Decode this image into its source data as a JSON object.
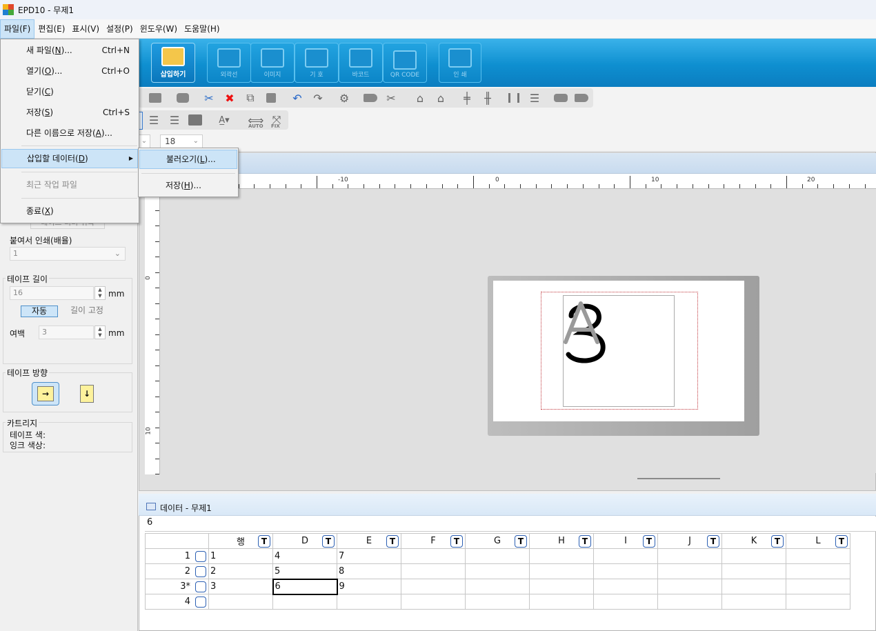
{
  "window": {
    "title": "EPD10 - 무제1"
  },
  "menubar": [
    {
      "label": "파일(F)",
      "active": true
    },
    {
      "label": "편집(E)"
    },
    {
      "label": "표시(V)"
    },
    {
      "label": "설정(P)"
    },
    {
      "label": "윈도우(W)"
    },
    {
      "label": "도움말(H)"
    }
  ],
  "file_menu": {
    "new": {
      "label": "새 파일(",
      "key": "N",
      "tail": ")...",
      "shortcut": "Ctrl+N"
    },
    "open": {
      "label": "열기(",
      "key": "O",
      "tail": ")...",
      "shortcut": "Ctrl+O"
    },
    "close": {
      "label": "닫기(",
      "key": "C",
      "tail": ")"
    },
    "save": {
      "label": "저장(",
      "key": "S",
      "tail": ")",
      "shortcut": "Ctrl+S"
    },
    "save_as": {
      "label": "다른 이름으로 저장(",
      "key": "A",
      "tail": ")..."
    },
    "insert_data": {
      "label": "삽입할 데이터(",
      "key": "D",
      "tail": ")"
    },
    "recent": {
      "label": "최근 작업 파일"
    },
    "exit": {
      "label": "종료(",
      "key": "X",
      "tail": ")"
    }
  },
  "insert_data_submenu": {
    "load": {
      "label": "불러오기(",
      "key": "L",
      "tail": ")..."
    },
    "save": {
      "label": "저장(",
      "key": "H",
      "tail": ")..."
    }
  },
  "ribbon": {
    "insert": "삽입하기",
    "outline": "외곽선",
    "image": "이미지",
    "symbol": "기 호",
    "barcode": "바코드",
    "qrcode": "QR CODE",
    "print": "인 쇄"
  },
  "toolbar": {
    "auto_label": "AUTO",
    "fix_label": "FIX",
    "font_size": "18"
  },
  "left_panel": {
    "cut_partial": "테이프 너비 취득",
    "paste_print_title": "붙여서 인쇄(배율)",
    "paste_print_value": "1",
    "tape_length_title": "테이프 길이",
    "tape_length_value": "16",
    "unit_mm": "mm",
    "auto_button": "자동",
    "fixed_length": "길이 고정",
    "margin_label": "여백",
    "margin_value": "3",
    "tape_direction_title": "테이프 방향",
    "cartridge_title": "카트리지",
    "tape_color_label": "테이프 색:",
    "ink_color_label": "잉크 색상:"
  },
  "ruler": {
    "h_labels": [
      "-10",
      "0",
      "10",
      "20"
    ],
    "v_labels": [
      "0",
      "10"
    ]
  },
  "data_panel": {
    "title": "데이터  - 무제1",
    "current_value": "6",
    "columns": [
      "행",
      "D",
      "E",
      "F",
      "G",
      "H",
      "I",
      "J",
      "K",
      "L"
    ],
    "rows": [
      {
        "label": "1",
        "cells": [
          "1",
          "4",
          "7",
          "",
          "",
          "",
          "",
          "",
          "",
          ""
        ]
      },
      {
        "label": "2",
        "cells": [
          "2",
          "5",
          "8",
          "",
          "",
          "",
          "",
          "",
          "",
          ""
        ]
      },
      {
        "label": "3*",
        "cells": [
          "3",
          "6",
          "9",
          "",
          "",
          "",
          "",
          "",
          "",
          ""
        ]
      },
      {
        "label": "4",
        "cells": [
          "",
          "",
          "",
          "",
          "",
          "",
          "",
          "",
          "",
          ""
        ]
      }
    ],
    "badge_letter": "T"
  },
  "colors": {
    "ribbon": "#0e8fd0",
    "highlight": "#cce4f7",
    "print_area": "#c0343a"
  }
}
